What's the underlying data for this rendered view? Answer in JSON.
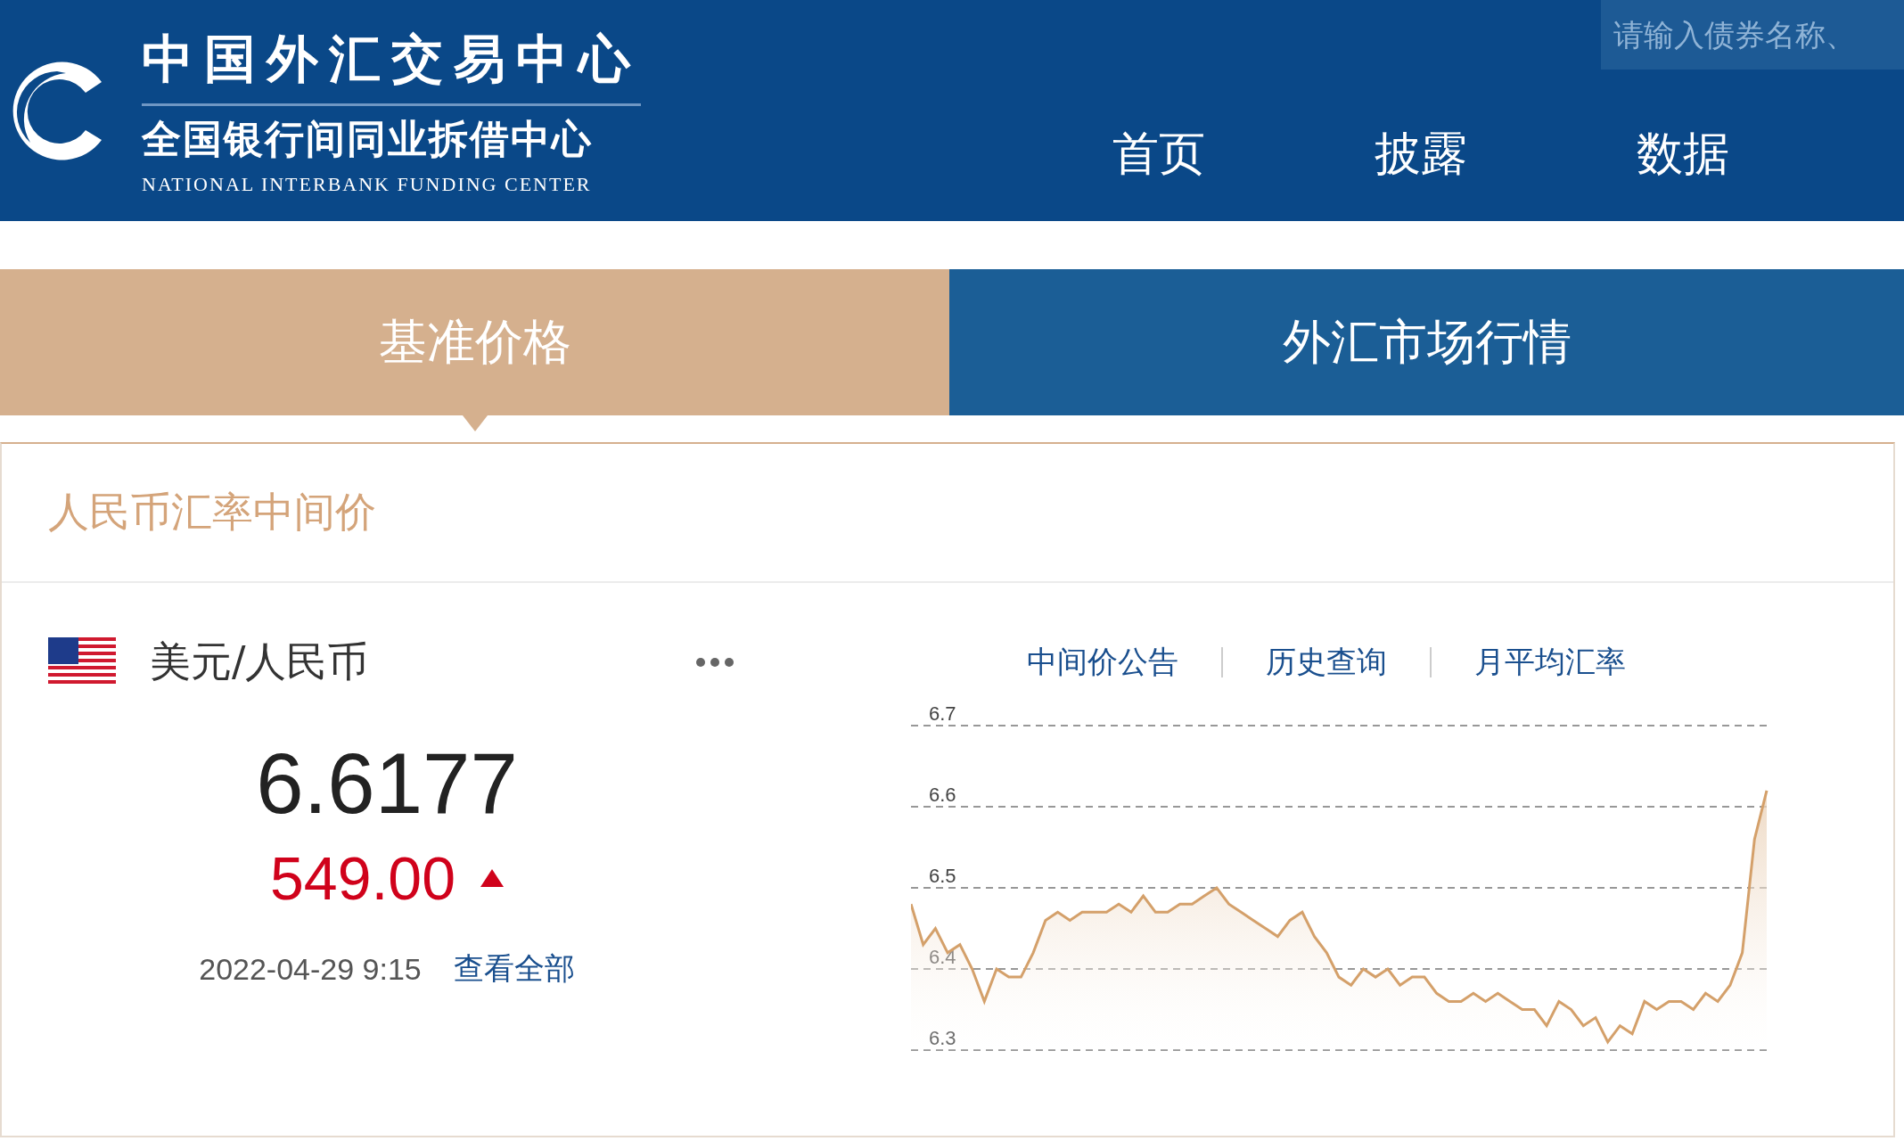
{
  "header": {
    "logo_title": "中国外汇交易中心",
    "logo_subtitle": "全国银行间同业拆借中心",
    "logo_english": "NATIONAL INTERBANK FUNDING CENTER",
    "search": {
      "placeholder": "请输入债券名称、"
    },
    "nav": [
      {
        "label": "首页"
      },
      {
        "label": "披露"
      },
      {
        "label": "数据"
      }
    ]
  },
  "tabs": [
    {
      "label": "基准价格",
      "selected": true
    },
    {
      "label": "外汇市场行情",
      "selected": false
    }
  ],
  "card": {
    "title": "人民币汇率中间价",
    "pair": "美元/人民币",
    "rate": "6.6177",
    "change": "549.00",
    "rising": true,
    "date": "2022-04-29 9:15",
    "view_all": "查看全部",
    "links": [
      "中间价公告",
      "历史查询",
      "月平均汇率"
    ],
    "chart_data": {
      "type": "area",
      "grid": true,
      "ylim": [
        6.3,
        6.7
      ],
      "yticks": [
        6.3,
        6.4,
        6.5,
        6.6,
        6.7
      ],
      "series": [
        {
          "color": "#d4a06a",
          "values": [
            6.48,
            6.43,
            6.45,
            6.42,
            6.43,
            6.4,
            6.36,
            6.4,
            6.39,
            6.39,
            6.42,
            6.46,
            6.47,
            6.46,
            6.47,
            6.47,
            6.47,
            6.48,
            6.47,
            6.49,
            6.47,
            6.47,
            6.48,
            6.48,
            6.49,
            6.5,
            6.48,
            6.47,
            6.46,
            6.45,
            6.44,
            6.46,
            6.47,
            6.44,
            6.42,
            6.39,
            6.38,
            6.4,
            6.39,
            6.4,
            6.38,
            6.39,
            6.39,
            6.37,
            6.36,
            6.36,
            6.37,
            6.36,
            6.37,
            6.36,
            6.35,
            6.35,
            6.33,
            6.36,
            6.35,
            6.33,
            6.34,
            6.31,
            6.33,
            6.32,
            6.36,
            6.35,
            6.36,
            6.36,
            6.35,
            6.37,
            6.36,
            6.38,
            6.42,
            6.56,
            6.62
          ]
        }
      ]
    }
  }
}
